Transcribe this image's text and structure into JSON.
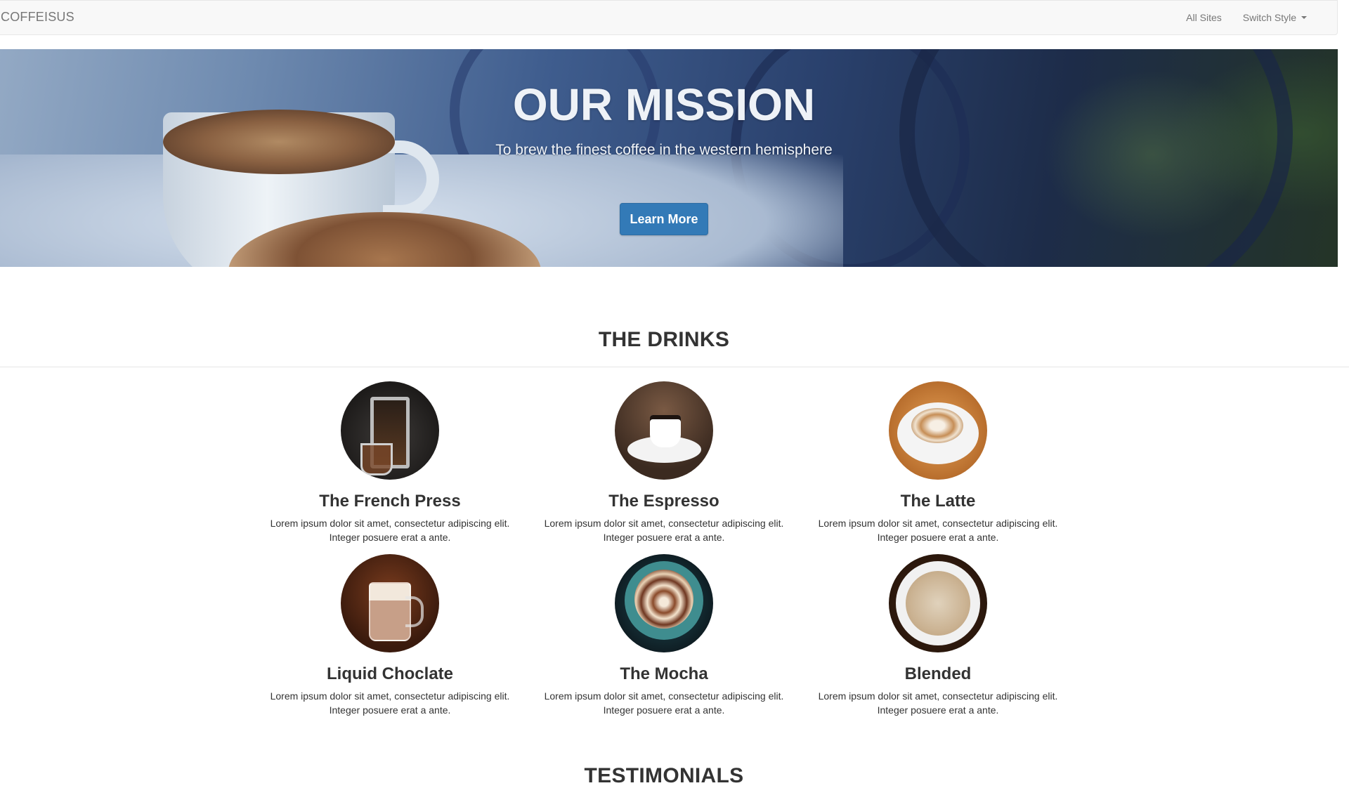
{
  "navbar": {
    "brand": "COFFEISUS",
    "links": [
      {
        "label": "All Sites"
      },
      {
        "label": "Switch Style"
      }
    ]
  },
  "hero": {
    "title": "OUR MISSION",
    "subtitle": "To brew the finest coffee in the western hemisphere",
    "button_label": "Learn More"
  },
  "drinks": {
    "title": "THE DRINKS",
    "items": [
      {
        "name": "The French Press",
        "description": "Lorem ipsum dolor sit amet, consectetur adipiscing elit. Integer posuere erat a ante."
      },
      {
        "name": "The Espresso",
        "description": "Lorem ipsum dolor sit amet, consectetur adipiscing elit. Integer posuere erat a ante."
      },
      {
        "name": "The Latte",
        "description": "Lorem ipsum dolor sit amet, consectetur adipiscing elit. Integer posuere erat a ante."
      },
      {
        "name": "Liquid Choclate",
        "description": "Lorem ipsum dolor sit amet, consectetur adipiscing elit. Integer posuere erat a ante."
      },
      {
        "name": "The Mocha",
        "description": "Lorem ipsum dolor sit amet, consectetur adipiscing elit. Integer posuere erat a ante."
      },
      {
        "name": "Blended",
        "description": "Lorem ipsum dolor sit amet, consectetur adipiscing elit. Integer posuere erat a ante."
      }
    ]
  },
  "testimonials": {
    "title": "TESTIMONIALS"
  },
  "colors": {
    "primary_button": "#337ab7",
    "navbar_bg": "#f8f8f8",
    "text": "#333333"
  }
}
